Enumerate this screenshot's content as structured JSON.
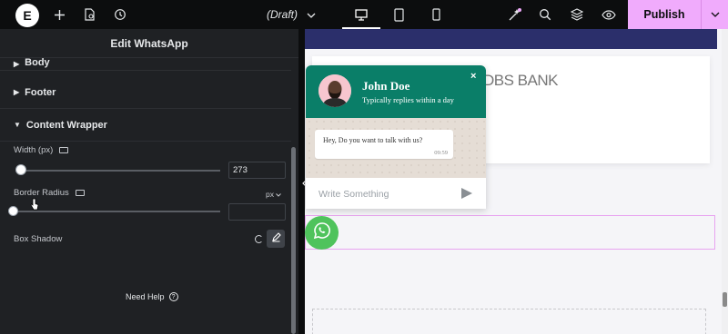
{
  "topbar": {
    "logo_letter": "E",
    "draft_label": "(Draft)",
    "publish_label": "Publish",
    "icons": [
      "plus-icon",
      "page-settings-icon",
      "history-icon",
      "desktop-icon",
      "tablet-icon",
      "mobile-icon",
      "ai-sparkle-icon",
      "search-icon",
      "layers-icon",
      "preview-eye-icon",
      "chevron-down-icon"
    ]
  },
  "sidebar": {
    "title": "Edit WhatsApp",
    "sections": {
      "body": "Body",
      "footer": "Footer",
      "content_wrapper": "Content Wrapper"
    },
    "width_label": "Width (px)",
    "width_value": "273",
    "border_radius_label": "Border Radius",
    "border_radius_unit": "px",
    "box_shadow_label": "Box Shadow",
    "need_help": "Need Help"
  },
  "canvas": {
    "brand_text": "DBS BANK",
    "whatsapp": {
      "name": "John Doe",
      "subtitle": "Typically replies within a day",
      "close": "×",
      "message": "Hey, Do you want to talk with us?",
      "time": "09:59",
      "input_placeholder": "Write Something"
    }
  },
  "colors": {
    "topbar_bg": "#0c0d0e",
    "sidebar_bg": "#1f2124",
    "publish_bg": "#f0abfc",
    "whatsapp_green": "#0a7e68",
    "fab_green": "#4fc35c",
    "navy_band": "#2b2f6b"
  }
}
